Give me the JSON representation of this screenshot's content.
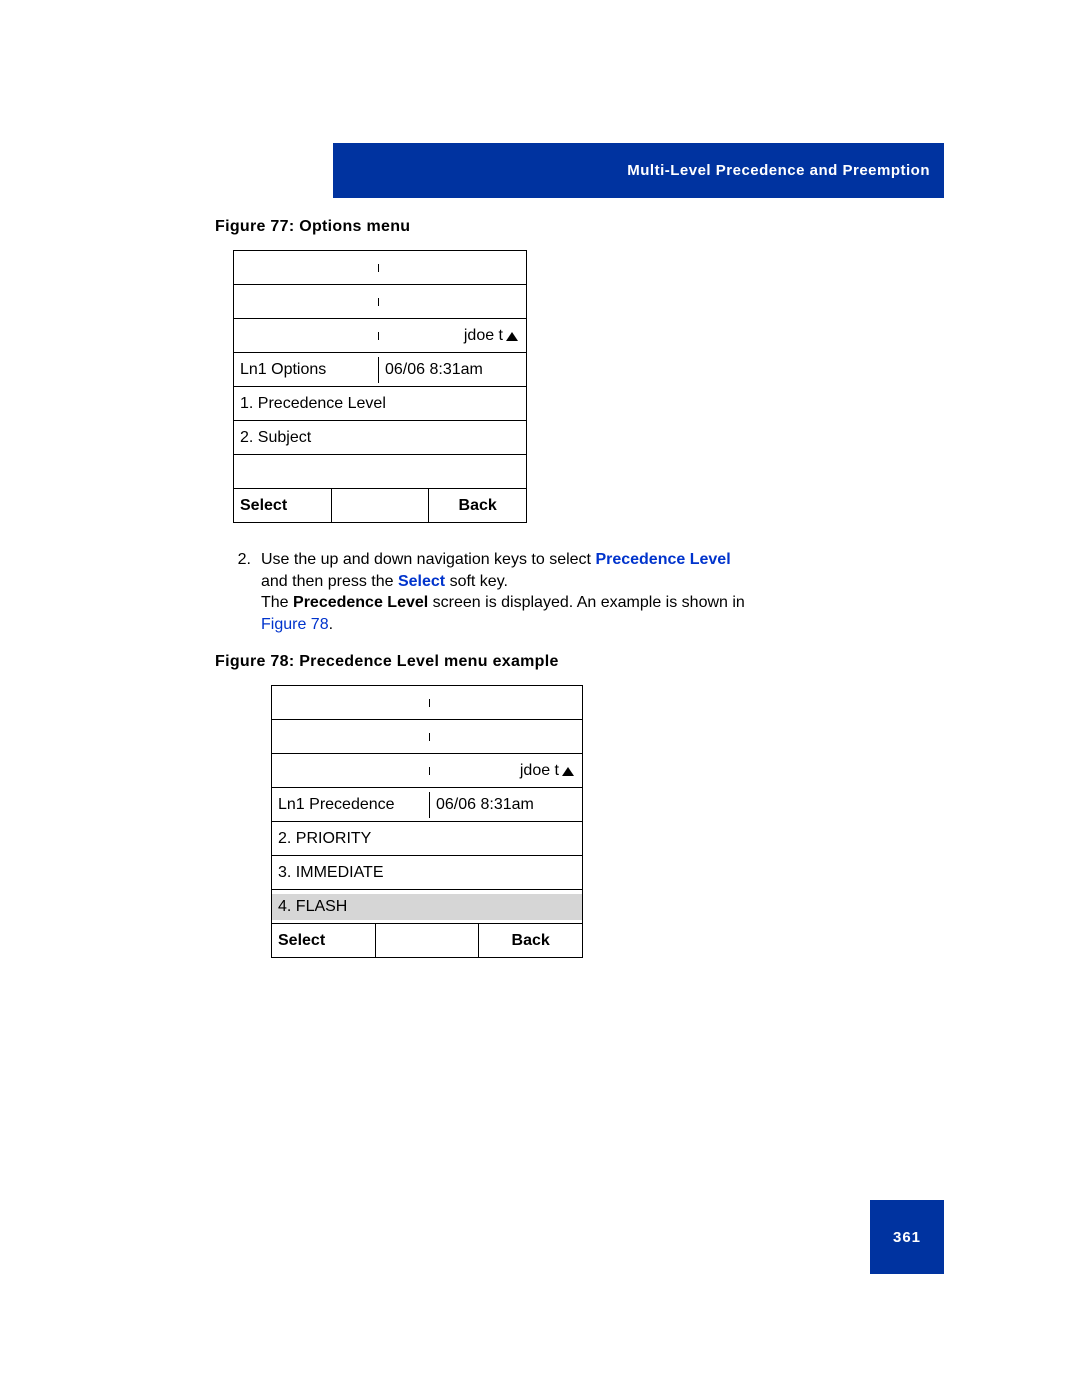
{
  "header": {
    "title": "Multi-Level Precedence and Preemption"
  },
  "figure77": {
    "caption": "Figure 77: Options menu",
    "status_user": "jdoe t",
    "line_label": "Ln1 Options",
    "datetime": "06/06 8:31am",
    "row1": "1. Precedence Level",
    "row2": "2. Subject",
    "soft_left": "Select",
    "soft_right": "Back"
  },
  "step": {
    "number": "2.",
    "line1a": "Use the up and down navigation keys to select ",
    "line1b": "Precedence Level",
    "line2a": "and then press the ",
    "line2b": "Select",
    "line2c": " soft key.",
    "line3a": "The ",
    "line3b": "Precedence Level",
    "line3c": " screen is displayed. An example is shown in ",
    "line4": "Figure 78",
    "line4b": "."
  },
  "figure78": {
    "caption": "Figure 78: Precedence Level menu example",
    "status_user": "jdoe t",
    "line_label": "Ln1 Precedence",
    "datetime": "06/06 8:31am",
    "row1": "2. PRIORITY",
    "row2": "3. IMMEDIATE",
    "row3": "4. FLASH",
    "soft_left": "Select",
    "soft_right": "Back"
  },
  "footer": {
    "page": "361"
  }
}
